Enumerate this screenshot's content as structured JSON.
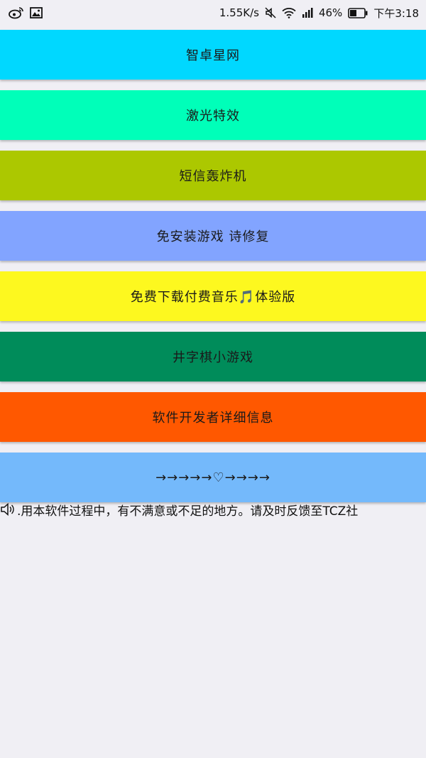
{
  "status_bar": {
    "speed": "1.55K/s",
    "battery_pct": "46%",
    "time": "下午3:18"
  },
  "menu": {
    "items": [
      {
        "label": "智卓星网",
        "color": "#00d8ff"
      },
      {
        "label": "激光特效",
        "color": "#00ffb9"
      },
      {
        "label": "短信轰炸机",
        "color": "#acc800"
      },
      {
        "label": "免安装游戏 诗修复",
        "color": "#82a4ff"
      },
      {
        "label": "免费下载付费音乐🎵体验版",
        "color": "#fdf81f"
      },
      {
        "label": "井字棋小游戏",
        "color": "#008c5a"
      },
      {
        "label": "软件开发者详细信息",
        "color": "#ff5800"
      },
      {
        "label": "→→→→→♡→→→→",
        "color": "#74b9fb"
      }
    ]
  },
  "notice": {
    "text": ".用本软件过程中，有不满意或不足的地方。请及时反馈至TCZ社"
  }
}
